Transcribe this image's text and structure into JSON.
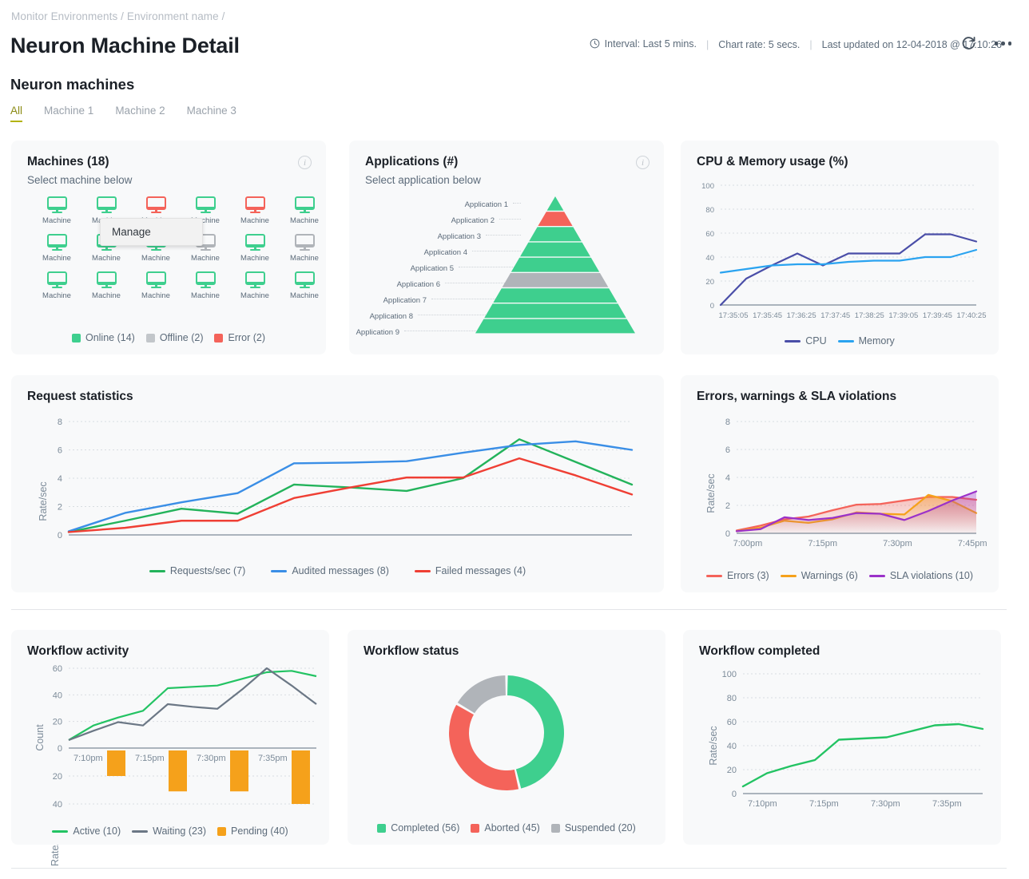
{
  "breadcrumb": "Monitor Environments / Environment name /",
  "page_title": "Neuron Machine Detail",
  "header_meta": {
    "interval": "Interval: Last 5 mins.",
    "chart_rate": "Chart rate: 5 secs.",
    "last_updated": "Last updated on 12-04-2018 @ 17:10:26",
    "separator": "|",
    "refresh_icon": "refresh-icon",
    "more_icon": "more-options-icon",
    "clock_icon": "clock-icon"
  },
  "section_title": "Neuron machines",
  "tabs": [
    {
      "label": "All",
      "active": true
    },
    {
      "label": "Machine 1",
      "active": false
    },
    {
      "label": "Machine 2",
      "active": false
    },
    {
      "label": "Machine 3",
      "active": false
    }
  ],
  "context_menu": {
    "items": [
      "Manage"
    ]
  },
  "machines_card": {
    "title": "Machines (18)",
    "subtitle": "Select machine below",
    "info_icon": "info-icon",
    "machine_label": "Machine",
    "states": [
      "online",
      "online",
      "error",
      "online",
      "error",
      "online",
      "online",
      "online",
      "online",
      "offline",
      "online",
      "offline",
      "online",
      "online",
      "online",
      "online",
      "online",
      "online"
    ],
    "legend": [
      {
        "label": "Online (14)",
        "color": "#3ecf8e"
      },
      {
        "label": "Offline (2)",
        "color": "#c2c6ca"
      },
      {
        "label": "Error (2)",
        "color": "#f4635a"
      }
    ]
  },
  "applications_card": {
    "title": "Applications (#)",
    "subtitle": "Select application below",
    "info_icon": "info-icon"
  },
  "colors": {
    "green": "#23c363",
    "funnel_green": "#3ecf8e",
    "red": "#f4635a",
    "gray": "#b0b4b9",
    "blue": "#36a2f5",
    "cpu_purple": "#4a4ea8",
    "memory_blue": "#2aa3f0",
    "orange": "#f5a11b",
    "purple": "#9b32c9",
    "req_green": "#23b35b",
    "req_blue": "#3a8ee6",
    "req_red": "#ef3f34",
    "slate": "#6b7785"
  },
  "chart_data": [
    {
      "id": "applications_funnel",
      "type": "funnel",
      "title": "Applications (#)",
      "categories": [
        "Application 1",
        "Application 2",
        "Application 3",
        "Application 4",
        "Application 5",
        "Application 6",
        "Application 7",
        "Application 8",
        "Application 9"
      ],
      "values": [
        9,
        8,
        7,
        6,
        5,
        4,
        3,
        2,
        1
      ],
      "segment_colors": [
        "#3ecf8e",
        "#f4635a",
        "#3ecf8e",
        "#3ecf8e",
        "#3ecf8e",
        "#b0b4b9",
        "#3ecf8e",
        "#3ecf8e",
        "#3ecf8e"
      ],
      "legend_position": "left"
    },
    {
      "id": "cpu_memory_usage",
      "type": "line",
      "title": "CPU & Memory usage (%)",
      "xlabel": "",
      "ylabel": "",
      "ylim": [
        0,
        100
      ],
      "yticks": [
        0,
        20,
        40,
        60,
        80,
        100
      ],
      "x": [
        "17:35:05",
        "17:35:45",
        "17:36:25",
        "17:37:45",
        "17:38:25",
        "17:39:05",
        "17:39:45",
        "17:40:25"
      ],
      "grid": true,
      "legend_position": "bottom",
      "series": [
        {
          "name": "CPU",
          "color": "#4a4ea8",
          "values": [
            0,
            22,
            33,
            43,
            33,
            43,
            43,
            43,
            59,
            59,
            53
          ]
        },
        {
          "name": "Memory",
          "color": "#2aa3f0",
          "values": [
            27,
            30,
            33,
            34,
            34,
            36,
            37,
            37,
            40,
            40,
            46
          ]
        }
      ]
    },
    {
      "id": "request_statistics",
      "type": "line",
      "title": "Request statistics",
      "xlabel": "",
      "ylabel": "Rate/sec",
      "ylim": [
        0,
        8
      ],
      "yticks": [
        0,
        2,
        4,
        6,
        8
      ],
      "grid": true,
      "legend_position": "bottom",
      "series": [
        {
          "name": "Requests/sec (7)",
          "color": "#23b35b",
          "values": [
            0.2,
            1.0,
            1.85,
            1.5,
            3.55,
            3.35,
            3.1,
            4.0,
            6.75,
            5.15,
            3.55
          ]
        },
        {
          "name": "Audited messages (8)",
          "color": "#3a8ee6",
          "values": [
            0.25,
            1.55,
            2.3,
            2.95,
            5.05,
            5.1,
            5.2,
            5.8,
            6.35,
            6.6,
            6.0
          ]
        },
        {
          "name": "Failed messages (4)",
          "color": "#ef3f34",
          "values": [
            0.2,
            0.5,
            1.0,
            1.0,
            2.6,
            3.35,
            4.05,
            4.05,
            5.4,
            4.2,
            2.85
          ]
        }
      ]
    },
    {
      "id": "errors_warnings_sla",
      "type": "area",
      "title": "Errors, warnings & SLA violations",
      "xlabel": "",
      "ylabel": "Rate/sec",
      "ylim": [
        0,
        8
      ],
      "yticks": [
        0,
        2,
        4,
        6,
        8
      ],
      "xticks": [
        "7:00pm",
        "7:15pm",
        "7:30pm",
        "7:45pm"
      ],
      "grid": true,
      "legend_position": "bottom",
      "series": [
        {
          "name": "Errors (3)",
          "color": "#f4635a",
          "values": [
            0.2,
            0.55,
            1.0,
            1.2,
            1.65,
            2.05,
            2.1,
            2.35,
            2.6,
            2.6,
            2.4
          ]
        },
        {
          "name": "Warnings (6)",
          "color": "#f5a11b",
          "values": [
            0.15,
            0.4,
            0.9,
            0.75,
            1.0,
            1.5,
            1.4,
            1.35,
            2.75,
            2.3,
            1.45
          ]
        },
        {
          "name": "SLA violations (10)",
          "color": "#9b32c9",
          "values": [
            0.15,
            0.3,
            1.15,
            0.95,
            1.1,
            1.45,
            1.4,
            0.95,
            1.6,
            2.35,
            3.0
          ]
        }
      ]
    },
    {
      "id": "workflow_activity",
      "type": "line-bar",
      "title": "Workflow activity",
      "xlabel": "",
      "ylabel": "Count",
      "ylim": [
        -40,
        60
      ],
      "yticks_top": [
        60,
        40,
        20,
        0
      ],
      "yticks_bottom": [
        20,
        40
      ],
      "xticks": [
        "7:10pm",
        "7:15pm",
        "7:30pm",
        "7:35pm"
      ],
      "grid": true,
      "legend_position": "bottom",
      "series": [
        {
          "name": "Active (10)",
          "type": "line",
          "color": "#23c363",
          "values": [
            6,
            17,
            23,
            28,
            45,
            46,
            47,
            52,
            57,
            58,
            54
          ]
        },
        {
          "name": "Waiting (23)",
          "type": "line",
          "color": "#6b7785",
          "values": [
            6,
            13,
            19.5,
            17,
            33,
            31,
            29.5,
            44,
            60,
            47,
            33
          ]
        },
        {
          "name": "Pending (40)",
          "type": "bar",
          "color": "#f5a11b",
          "values": [
            20,
            31,
            31,
            40
          ]
        }
      ]
    },
    {
      "id": "workflow_status",
      "type": "pie",
      "title": "Workflow status",
      "labels": [
        "Completed (56)",
        "Aborted (45)",
        "Suspended (20)"
      ],
      "values": [
        56,
        45,
        20
      ],
      "colors": [
        "#3ecf8e",
        "#f4635a",
        "#b0b4b9"
      ],
      "donut": true,
      "legend_position": "bottom"
    },
    {
      "id": "workflow_completed",
      "type": "line",
      "title": "Workflow completed",
      "xlabel": "",
      "ylabel": "Rate/sec",
      "ylim": [
        0,
        100
      ],
      "yticks": [
        0,
        20,
        40,
        60,
        80,
        100
      ],
      "xticks": [
        "7:10pm",
        "7:15pm",
        "7:30pm",
        "7:35pm"
      ],
      "grid": true,
      "series": [
        {
          "name": "Workflow completed",
          "color": "#23c363",
          "values": [
            6,
            17,
            23,
            28,
            45,
            46,
            47,
            52,
            57,
            58,
            54
          ]
        }
      ]
    }
  ]
}
